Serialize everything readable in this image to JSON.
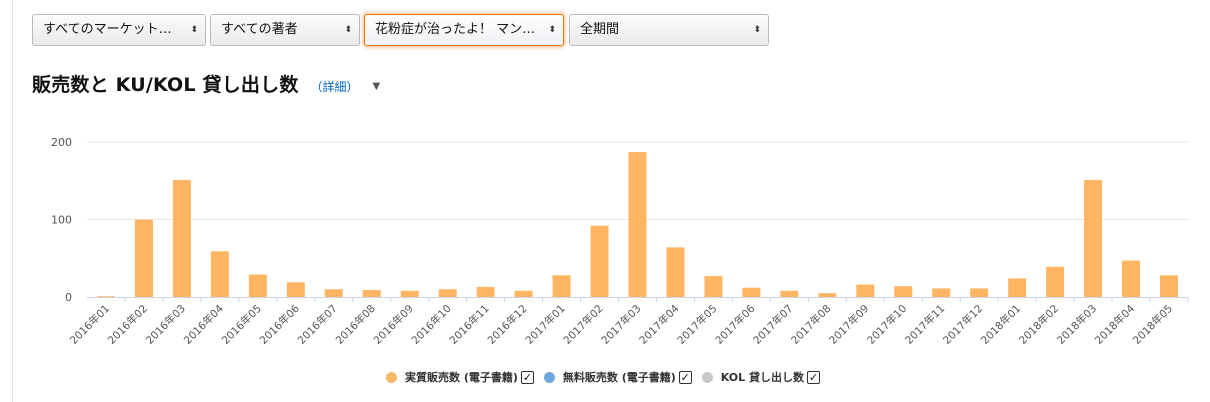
{
  "filters": {
    "marketplace": "すべてのマーケット…",
    "author": "すべての著者",
    "title": "花粉症が治ったよ！ マン…",
    "period": "全期間",
    "arrows": "⬍"
  },
  "heading": {
    "title": "販売数と KU/KOL 貸し出し数",
    "detail": "（詳細）",
    "caret": "▼"
  },
  "legend": {
    "items": [
      {
        "label": "実質販売数 (電子書籍)",
        "color": "#f7b867",
        "checked": "✓"
      },
      {
        "label": "無料販売数 (電子書籍)",
        "color": "#6fa8dc",
        "checked": "✓"
      },
      {
        "label": "KOL 貸し出し数",
        "color": "#c8c8c8",
        "checked": "✓"
      }
    ]
  },
  "colors": {
    "bar": "#ffb562",
    "grid": "#e6e6e6",
    "axis": "#c8d4e8",
    "label": "#555555"
  },
  "chart_data": {
    "type": "bar",
    "categories": [
      "2016年01",
      "2016年02",
      "2016年03",
      "2016年04",
      "2016年05",
      "2016年06",
      "2016年07",
      "2016年08",
      "2016年09",
      "2016年10",
      "2016年11",
      "2016年12",
      "2017年01",
      "2017年02",
      "2017年03",
      "2017年04",
      "2017年05",
      "2017年06",
      "2017年07",
      "2017年08",
      "2017年09",
      "2017年10",
      "2017年11",
      "2017年12",
      "2018年01",
      "2018年02",
      "2018年03",
      "2018年04",
      "2018年05"
    ],
    "series": [
      {
        "name": "実質販売数 (電子書籍)",
        "values": [
          1,
          100,
          151,
          59,
          29,
          19,
          10,
          9,
          8,
          10,
          13,
          8,
          28,
          92,
          187,
          64,
          27,
          12,
          8,
          5,
          16,
          14,
          11,
          11,
          24,
          39,
          151,
          47,
          28
        ]
      }
    ],
    "yticks": [
      0,
      100,
      200
    ],
    "ylim": [
      0,
      200
    ],
    "grid": true,
    "legend_position": "bottom"
  }
}
